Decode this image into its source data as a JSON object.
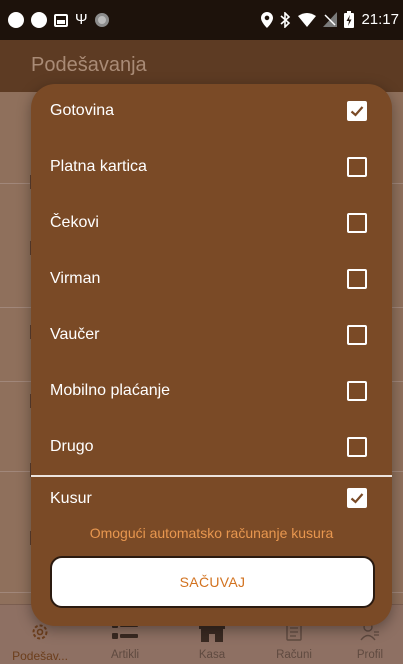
{
  "status_bar": {
    "time": "21:17",
    "left_icons": [
      "notification-dot-icon",
      "notification-dot-icon",
      "gallery-icon",
      "usb-icon",
      "record-icon"
    ],
    "right_icons": [
      "location-icon",
      "bluetooth-icon",
      "wifi-icon",
      "no-signal-icon",
      "battery-charging-icon"
    ]
  },
  "header": {
    "title": "Podešavanja"
  },
  "dialog": {
    "options": [
      {
        "label": "Gotovina",
        "checked": true
      },
      {
        "label": "Platna kartica",
        "checked": false
      },
      {
        "label": "Čekovi",
        "checked": false
      },
      {
        "label": "Virman",
        "checked": false
      },
      {
        "label": "Vaučer",
        "checked": false
      },
      {
        "label": "Mobilno plaćanje",
        "checked": false
      },
      {
        "label": "Drugo",
        "checked": false
      }
    ],
    "kusur": {
      "label": "Kusur",
      "checked": true,
      "hint": "Omogući automatsko računanje kusura"
    },
    "save_label": "SAČUVAJ"
  },
  "bottom_nav": [
    {
      "label": "Podešav...",
      "icon": "settings-icon",
      "active": true
    },
    {
      "label": "Artikli",
      "icon": "list-icon",
      "active": false
    },
    {
      "label": "Kasa",
      "icon": "store-icon",
      "active": false
    },
    {
      "label": "Računi",
      "icon": "receipt-icon",
      "active": false
    },
    {
      "label": "Profil",
      "icon": "profile-icon",
      "active": false
    }
  ],
  "colors": {
    "dialog_bg": "#7a4a26",
    "status_bar_bg": "#1d120b",
    "hint_text": "#e8974f",
    "save_text": "#d2721f",
    "active_nav": "#6c3e1c"
  }
}
